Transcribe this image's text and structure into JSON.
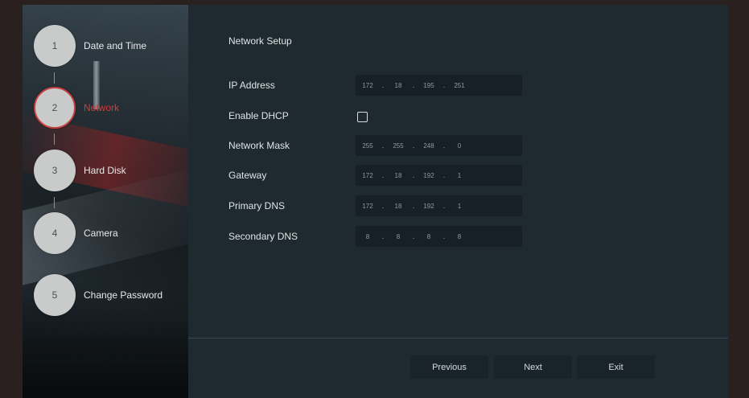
{
  "wizard": {
    "steps": [
      {
        "number": "1",
        "label": "Date and Time"
      },
      {
        "number": "2",
        "label": "Network"
      },
      {
        "number": "3",
        "label": "Hard Disk"
      },
      {
        "number": "4",
        "label": "Camera"
      },
      {
        "number": "5",
        "label": "Change Password"
      }
    ],
    "active_step": "2"
  },
  "network": {
    "title": "Network Setup",
    "ip_address": {
      "label": "IP Address",
      "octets": [
        "172",
        "18",
        "195",
        "251"
      ]
    },
    "dhcp": {
      "label": "Enable DHCP",
      "checked": false
    },
    "network_mask": {
      "label": "Network Mask",
      "octets": [
        "255",
        "255",
        "248",
        "0"
      ]
    },
    "gateway": {
      "label": "Gateway",
      "octets": [
        "172",
        "18",
        "192",
        "1"
      ]
    },
    "primary_dns": {
      "label": "Primary DNS",
      "octets": [
        "172",
        "18",
        "192",
        "1"
      ]
    },
    "secondary_dns": {
      "label": "Secondary DNS",
      "octets": [
        "8",
        "8",
        "8",
        "8"
      ]
    }
  },
  "footer": {
    "previous_label": "Previous",
    "next_label": "Next",
    "exit_label": "Exit"
  },
  "colors": {
    "active_step": "#d33a3a",
    "panel_bg": "#1e2930",
    "field_bg": "#162026"
  }
}
